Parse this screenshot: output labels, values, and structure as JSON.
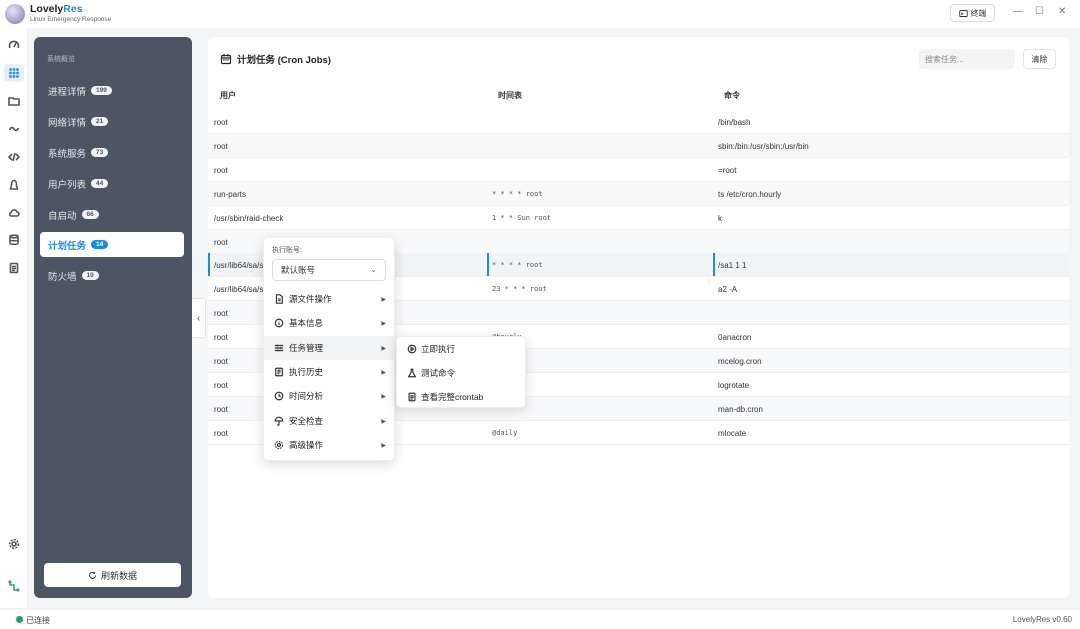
{
  "app": {
    "name_main": "Lovely",
    "name_accent": "Res",
    "subtitle": "Linux Emergency Response"
  },
  "titlebar": {
    "terminal_label": "终端",
    "minimize": "—",
    "maximize": "☐",
    "close": "✕"
  },
  "nav": {
    "header": "系统概览",
    "items": [
      {
        "label": "进程详情",
        "badge": "199"
      },
      {
        "label": "网络详情",
        "badge": "21"
      },
      {
        "label": "系统服务",
        "badge": "73"
      },
      {
        "label": "用户列表",
        "badge": "44"
      },
      {
        "label": "自启动",
        "badge": "66"
      },
      {
        "label": "计划任务",
        "badge": "14"
      },
      {
        "label": "防火墙",
        "badge": "10"
      }
    ],
    "refresh_label": "刷新数据",
    "collapse_glyph": "‹"
  },
  "main": {
    "title": "计划任务 (Cron Jobs)",
    "search_placeholder": "搜索任务...",
    "clear_label": "清除",
    "columns": [
      "用户",
      "时间表",
      "命令"
    ],
    "rows": [
      {
        "user": "root",
        "schedule": "",
        "command": "/bin/bash"
      },
      {
        "user": "root",
        "schedule": "",
        "command": "sbin:/bin:/usr/sbin:/usr/bin"
      },
      {
        "user": "root",
        "schedule": "",
        "command": "=root"
      },
      {
        "user": "run-parts",
        "schedule": "* * * * root",
        "command": "ts /etc/cron.hourly"
      },
      {
        "user": "/usr/sbin/raid-check",
        "schedule": "1 * * Sun root",
        "command": "k"
      },
      {
        "user": "root",
        "schedule": "",
        "command": ""
      },
      {
        "user": "/usr/lib64/sa/s",
        "schedule": "* * * * root",
        "command": "/sa1 1 1"
      },
      {
        "user": "/usr/lib64/sa/s",
        "schedule": "23 * * * root",
        "command": "a2 -A"
      },
      {
        "user": "root",
        "schedule": "",
        "command": ""
      },
      {
        "user": "root",
        "schedule": "@hourly",
        "command": "0anacron"
      },
      {
        "user": "root",
        "schedule": "",
        "command": "mcelog.cron"
      },
      {
        "user": "root",
        "schedule": "",
        "command": "logrotate"
      },
      {
        "user": "root",
        "schedule": "",
        "command": "man-db.cron"
      },
      {
        "user": "root",
        "schedule": "@daily",
        "command": "mlocate"
      }
    ]
  },
  "context_menu": {
    "account_label": "执行账号:",
    "account_value": "默认账号",
    "items": [
      {
        "label": "源文件操作"
      },
      {
        "label": "基本信息"
      },
      {
        "label": "任务管理"
      },
      {
        "label": "执行历史"
      },
      {
        "label": "时间分析"
      },
      {
        "label": "安全检查"
      },
      {
        "label": "高级操作"
      }
    ],
    "arrow": "▶"
  },
  "submenu": {
    "items": [
      {
        "label": "立即执行"
      },
      {
        "label": "测试命令"
      },
      {
        "label": "查看完整crontab"
      }
    ]
  },
  "status": {
    "connection": "已连接",
    "version": "LovelyRes v0.60"
  },
  "colors": {
    "accent": "#1f8be0",
    "nav_bg": "#4b5563",
    "connected": "#22a06b"
  }
}
